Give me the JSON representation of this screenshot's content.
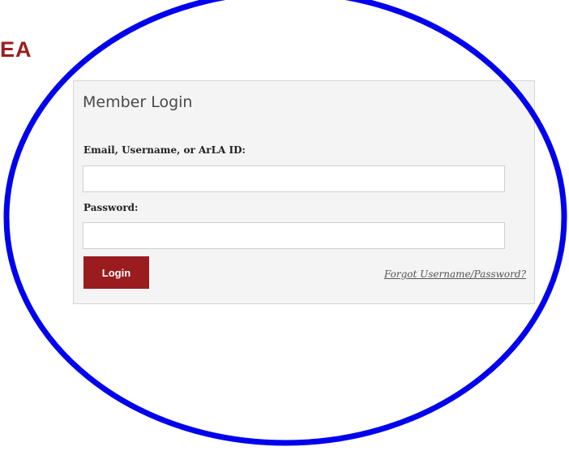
{
  "page": {
    "heading_fragment": "EA"
  },
  "login": {
    "title": "Member Login",
    "email_label": "Email, Username, or ArLA ID:",
    "email_value": "",
    "password_label": "Password:",
    "password_value": "",
    "login_button_label": "Login",
    "forgot_link": "Forgot Username/Password?"
  },
  "colors": {
    "brand_red": "#9b1c1f",
    "annotation_blue": "#0000ee",
    "panel_background": "#f4f4f4"
  }
}
